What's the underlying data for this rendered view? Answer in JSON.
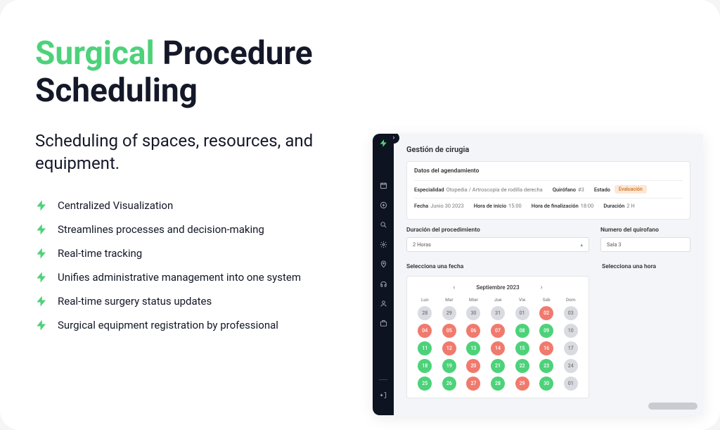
{
  "hero": {
    "title_accent": "Surgical",
    "title_rest": "Procedure Scheduling",
    "subtitle": "Scheduling of spaces, resources, and equipment."
  },
  "features": [
    "Centralized Visualization",
    "Streamlines processes and decision-making",
    "Real-time tracking",
    "Unifies administrative management into one system",
    "Real-time surgery status updates",
    "Surgical equipment registration by professional"
  ],
  "app": {
    "title": "Gestión de cirugia",
    "panel_title": "Datos del agendamiento",
    "row1": {
      "especialidad_label": "Especialidad",
      "especialidad_value": "Otopedia / Artroscopia de rodilla derecha",
      "quirofano_label": "Quirófano",
      "quirofano_value": "#3",
      "estado_label": "Estado",
      "estado_value": "Evaluación"
    },
    "row2": {
      "fecha_label": "Fecha",
      "fecha_value": "Junio 30 2023",
      "inicio_label": "Hora de inicio",
      "inicio_value": "15:00",
      "fin_label": "Hora de finalización",
      "fin_value": "18:00",
      "duracion_label": "Duración",
      "duracion_value": "2 H"
    },
    "form": {
      "duracion_label": "Duración del procedimiento",
      "duracion_value": "2 Horas",
      "quirofano_label": "Numero del quirofano",
      "quirofano_value": "Sala 3"
    },
    "date_section": "Selecciona una fecha",
    "time_section": "Selecciona una hora",
    "calendar": {
      "month": "Septiembre  2023",
      "dow": [
        "Lun",
        "Mar",
        "Mier",
        "Jue",
        "Vie",
        "Sab",
        "Dom"
      ],
      "days": [
        {
          "n": "28",
          "c": "gray"
        },
        {
          "n": "29",
          "c": "gray"
        },
        {
          "n": "30",
          "c": "gray"
        },
        {
          "n": "31",
          "c": "gray"
        },
        {
          "n": "01",
          "c": "gray"
        },
        {
          "n": "02",
          "c": "red"
        },
        {
          "n": "03",
          "c": "gray"
        },
        {
          "n": "04",
          "c": "red"
        },
        {
          "n": "05",
          "c": "red"
        },
        {
          "n": "06",
          "c": "red"
        },
        {
          "n": "07",
          "c": "red"
        },
        {
          "n": "08",
          "c": "green"
        },
        {
          "n": "09",
          "c": "green"
        },
        {
          "n": "10",
          "c": "gray"
        },
        {
          "n": "11",
          "c": "green"
        },
        {
          "n": "12",
          "c": "red"
        },
        {
          "n": "13",
          "c": "green"
        },
        {
          "n": "14",
          "c": "red"
        },
        {
          "n": "15",
          "c": "green"
        },
        {
          "n": "16",
          "c": "red"
        },
        {
          "n": "17",
          "c": "gray"
        },
        {
          "n": "18",
          "c": "green"
        },
        {
          "n": "19",
          "c": "green"
        },
        {
          "n": "20",
          "c": "red"
        },
        {
          "n": "21",
          "c": "green"
        },
        {
          "n": "22",
          "c": "green"
        },
        {
          "n": "23",
          "c": "green"
        },
        {
          "n": "24",
          "c": "gray"
        },
        {
          "n": "25",
          "c": "green"
        },
        {
          "n": "26",
          "c": "green"
        },
        {
          "n": "27",
          "c": "red"
        },
        {
          "n": "28",
          "c": "green"
        },
        {
          "n": "29",
          "c": "red"
        },
        {
          "n": "30",
          "c": "green"
        },
        {
          "n": "01",
          "c": "gray"
        }
      ]
    }
  }
}
